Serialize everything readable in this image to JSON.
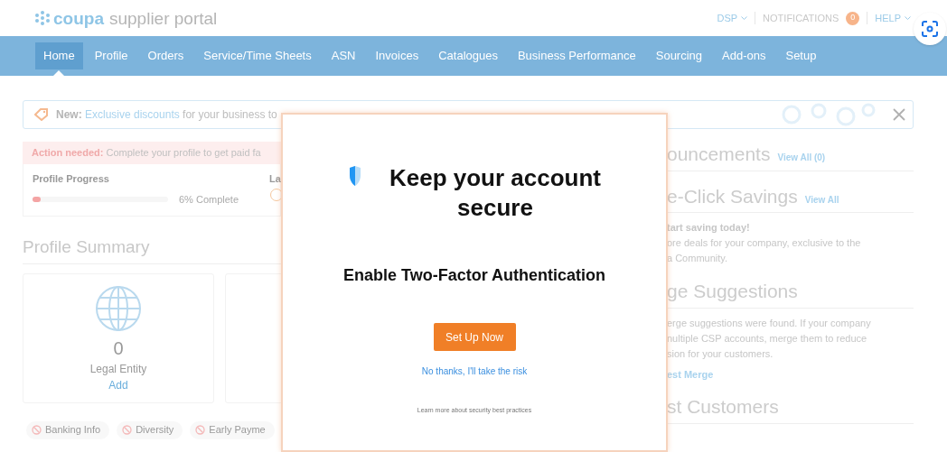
{
  "header": {
    "logo_brand": "coupa",
    "logo_text": "supplier portal",
    "menus": [
      {
        "label": "DSP",
        "kind": "dropdown"
      },
      {
        "label": "NOTIFICATIONS",
        "kind": "badge",
        "badge": "0"
      },
      {
        "label": "HELP",
        "kind": "dropdown"
      }
    ]
  },
  "nav": [
    {
      "label": "Home",
      "selected": true
    },
    {
      "label": "Profile",
      "selected": false
    },
    {
      "label": "Orders",
      "selected": false
    },
    {
      "label": "Service/Time Sheets",
      "selected": false
    },
    {
      "label": "ASN",
      "selected": false
    },
    {
      "label": "Invoices",
      "selected": false
    },
    {
      "label": "Catalogues",
      "selected": false
    },
    {
      "label": "Business Performance",
      "selected": false
    },
    {
      "label": "Sourcing",
      "selected": false
    },
    {
      "label": "Add-ons",
      "selected": false
    },
    {
      "label": "Setup",
      "selected": false
    }
  ],
  "banner": {
    "lead": "New:",
    "link": "Exclusive discounts",
    "text": "for your business to"
  },
  "action": {
    "lead": "Action needed:",
    "text": "Complete your profile to get paid fa"
  },
  "progress": {
    "label": "Profile Progress",
    "level": 0.06,
    "reading": "6% Complete",
    "column_2": "La"
  },
  "profile_summary": {
    "title": "Profile Summary",
    "cards": [
      {
        "count": "0",
        "label": "Legal Entity",
        "action": "Add"
      }
    ],
    "tags": [
      "Banking Info",
      "Diversity",
      "Early Payme"
    ]
  },
  "right": [
    {
      "title": "ouncements",
      "link": "View All (0)"
    },
    {
      "title": "e-Click Savings",
      "link": "View All",
      "lines": [
        "**tart saving today!**",
        "ore deals for your company, exclusive to the",
        "a Community."
      ]
    },
    {
      "title": "ge Suggestions",
      "lines": [
        "erge suggestions were found. If your company",
        "nultiple CSP accounts, merge them to reduce",
        "sion for your customers."
      ],
      "action": "est Merge"
    },
    {
      "title": "st Customers"
    }
  ],
  "modal": {
    "title": "Keep your account secure",
    "subtitle": "Enable Two-Factor Authentication",
    "button": "Set Up Now",
    "decline": "No thanks, I'll take the risk",
    "learn_more": "Learn more about security best practices"
  }
}
